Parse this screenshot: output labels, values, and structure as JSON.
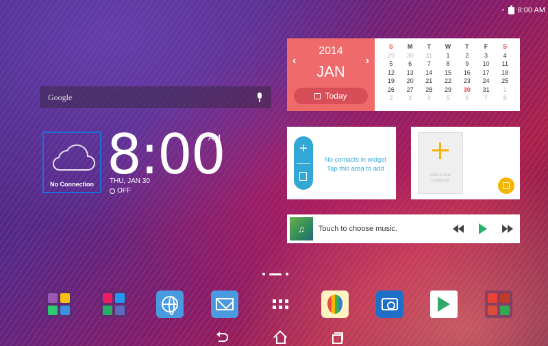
{
  "status_bar": {
    "time": "8:00 AM"
  },
  "search": {
    "label": "Google"
  },
  "weather": {
    "status": "No Connection"
  },
  "clock": {
    "time": "8:00",
    "ampm": "AM",
    "date": "THU, JAN 30",
    "alarm": "OFF"
  },
  "calendar": {
    "year": "2014",
    "month": "JAN",
    "prev": "‹",
    "next": "›",
    "today_label": "Today",
    "headers": [
      "S",
      "M",
      "T",
      "W",
      "T",
      "F",
      "S"
    ],
    "weeks": [
      [
        "29",
        "30",
        "31",
        "1",
        "2",
        "3",
        "4"
      ],
      [
        "5",
        "6",
        "7",
        "8",
        "9",
        "10",
        "11"
      ],
      [
        "12",
        "13",
        "14",
        "15",
        "16",
        "17",
        "18"
      ],
      [
        "19",
        "20",
        "21",
        "22",
        "23",
        "24",
        "25"
      ],
      [
        "26",
        "27",
        "28",
        "29",
        "30",
        "31",
        "1"
      ],
      [
        "2",
        "3",
        "4",
        "5",
        "6",
        "7",
        "8"
      ]
    ]
  },
  "contacts": {
    "add": "+",
    "line1": "No contacts in widget",
    "line2": "Tap this area to add"
  },
  "notebook": {
    "line1": "Add a new",
    "line2": "notebook"
  },
  "music": {
    "art_glyph": "♫",
    "text": "Touch to choose music."
  },
  "dock": [
    {
      "name": "folder-1"
    },
    {
      "name": "folder-2"
    },
    {
      "name": "browser"
    },
    {
      "name": "email"
    },
    {
      "name": "all-apps"
    },
    {
      "name": "gallery"
    },
    {
      "name": "camera"
    },
    {
      "name": "play-store"
    },
    {
      "name": "google-folder"
    }
  ],
  "colors": {
    "calendar_accent": "#ef6a6a",
    "contacts_accent": "#33a8d6",
    "notebook_accent": "#f5b400",
    "play_green": "#27b168"
  }
}
